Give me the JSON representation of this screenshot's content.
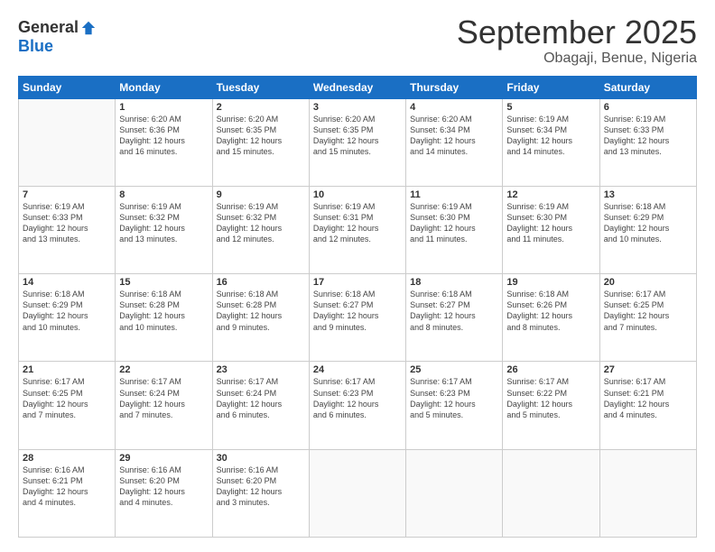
{
  "logo": {
    "general": "General",
    "blue": "Blue"
  },
  "title": "September 2025",
  "subtitle": "Obagaji, Benue, Nigeria",
  "days_header": [
    "Sunday",
    "Monday",
    "Tuesday",
    "Wednesday",
    "Thursday",
    "Friday",
    "Saturday"
  ],
  "weeks": [
    [
      {
        "num": "",
        "info": ""
      },
      {
        "num": "1",
        "info": "Sunrise: 6:20 AM\nSunset: 6:36 PM\nDaylight: 12 hours\nand 16 minutes."
      },
      {
        "num": "2",
        "info": "Sunrise: 6:20 AM\nSunset: 6:35 PM\nDaylight: 12 hours\nand 15 minutes."
      },
      {
        "num": "3",
        "info": "Sunrise: 6:20 AM\nSunset: 6:35 PM\nDaylight: 12 hours\nand 15 minutes."
      },
      {
        "num": "4",
        "info": "Sunrise: 6:20 AM\nSunset: 6:34 PM\nDaylight: 12 hours\nand 14 minutes."
      },
      {
        "num": "5",
        "info": "Sunrise: 6:19 AM\nSunset: 6:34 PM\nDaylight: 12 hours\nand 14 minutes."
      },
      {
        "num": "6",
        "info": "Sunrise: 6:19 AM\nSunset: 6:33 PM\nDaylight: 12 hours\nand 13 minutes."
      }
    ],
    [
      {
        "num": "7",
        "info": "Sunrise: 6:19 AM\nSunset: 6:33 PM\nDaylight: 12 hours\nand 13 minutes."
      },
      {
        "num": "8",
        "info": "Sunrise: 6:19 AM\nSunset: 6:32 PM\nDaylight: 12 hours\nand 13 minutes."
      },
      {
        "num": "9",
        "info": "Sunrise: 6:19 AM\nSunset: 6:32 PM\nDaylight: 12 hours\nand 12 minutes."
      },
      {
        "num": "10",
        "info": "Sunrise: 6:19 AM\nSunset: 6:31 PM\nDaylight: 12 hours\nand 12 minutes."
      },
      {
        "num": "11",
        "info": "Sunrise: 6:19 AM\nSunset: 6:30 PM\nDaylight: 12 hours\nand 11 minutes."
      },
      {
        "num": "12",
        "info": "Sunrise: 6:19 AM\nSunset: 6:30 PM\nDaylight: 12 hours\nand 11 minutes."
      },
      {
        "num": "13",
        "info": "Sunrise: 6:18 AM\nSunset: 6:29 PM\nDaylight: 12 hours\nand 10 minutes."
      }
    ],
    [
      {
        "num": "14",
        "info": "Sunrise: 6:18 AM\nSunset: 6:29 PM\nDaylight: 12 hours\nand 10 minutes."
      },
      {
        "num": "15",
        "info": "Sunrise: 6:18 AM\nSunset: 6:28 PM\nDaylight: 12 hours\nand 10 minutes."
      },
      {
        "num": "16",
        "info": "Sunrise: 6:18 AM\nSunset: 6:28 PM\nDaylight: 12 hours\nand 9 minutes."
      },
      {
        "num": "17",
        "info": "Sunrise: 6:18 AM\nSunset: 6:27 PM\nDaylight: 12 hours\nand 9 minutes."
      },
      {
        "num": "18",
        "info": "Sunrise: 6:18 AM\nSunset: 6:27 PM\nDaylight: 12 hours\nand 8 minutes."
      },
      {
        "num": "19",
        "info": "Sunrise: 6:18 AM\nSunset: 6:26 PM\nDaylight: 12 hours\nand 8 minutes."
      },
      {
        "num": "20",
        "info": "Sunrise: 6:17 AM\nSunset: 6:25 PM\nDaylight: 12 hours\nand 7 minutes."
      }
    ],
    [
      {
        "num": "21",
        "info": "Sunrise: 6:17 AM\nSunset: 6:25 PM\nDaylight: 12 hours\nand 7 minutes."
      },
      {
        "num": "22",
        "info": "Sunrise: 6:17 AM\nSunset: 6:24 PM\nDaylight: 12 hours\nand 7 minutes."
      },
      {
        "num": "23",
        "info": "Sunrise: 6:17 AM\nSunset: 6:24 PM\nDaylight: 12 hours\nand 6 minutes."
      },
      {
        "num": "24",
        "info": "Sunrise: 6:17 AM\nSunset: 6:23 PM\nDaylight: 12 hours\nand 6 minutes."
      },
      {
        "num": "25",
        "info": "Sunrise: 6:17 AM\nSunset: 6:23 PM\nDaylight: 12 hours\nand 5 minutes."
      },
      {
        "num": "26",
        "info": "Sunrise: 6:17 AM\nSunset: 6:22 PM\nDaylight: 12 hours\nand 5 minutes."
      },
      {
        "num": "27",
        "info": "Sunrise: 6:17 AM\nSunset: 6:21 PM\nDaylight: 12 hours\nand 4 minutes."
      }
    ],
    [
      {
        "num": "28",
        "info": "Sunrise: 6:16 AM\nSunset: 6:21 PM\nDaylight: 12 hours\nand 4 minutes."
      },
      {
        "num": "29",
        "info": "Sunrise: 6:16 AM\nSunset: 6:20 PM\nDaylight: 12 hours\nand 4 minutes."
      },
      {
        "num": "30",
        "info": "Sunrise: 6:16 AM\nSunset: 6:20 PM\nDaylight: 12 hours\nand 3 minutes."
      },
      {
        "num": "",
        "info": ""
      },
      {
        "num": "",
        "info": ""
      },
      {
        "num": "",
        "info": ""
      },
      {
        "num": "",
        "info": ""
      }
    ]
  ]
}
